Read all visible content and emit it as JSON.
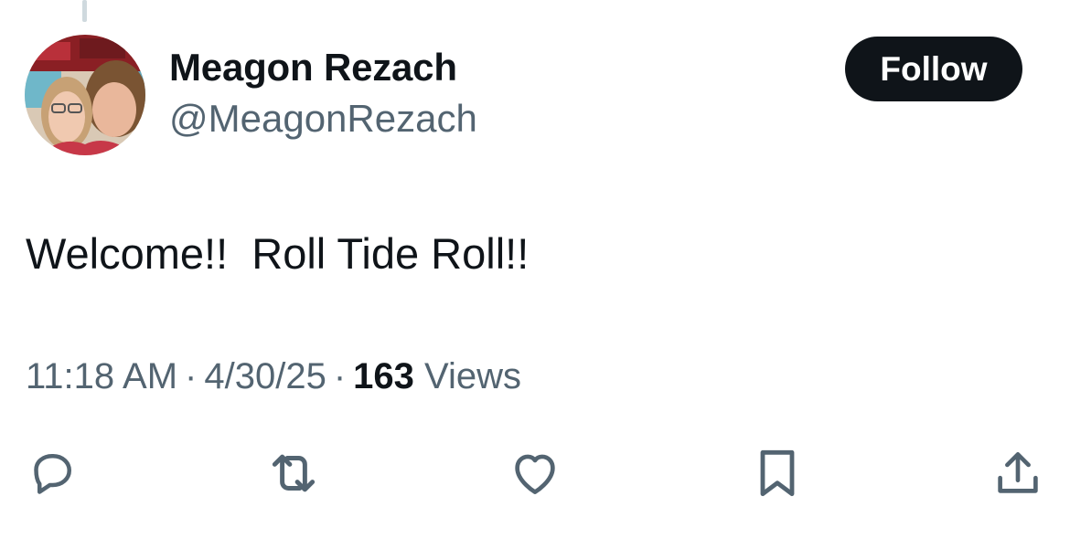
{
  "tweet": {
    "author_name": "Meagon Rezach",
    "author_handle": "@MeagonRezach",
    "follow_label": "Follow",
    "text": "Welcome!!  Roll Tide Roll!!",
    "time": "11:18 AM",
    "separator": "·",
    "date": "4/30/25",
    "views_count": "163",
    "views_label": "Views"
  },
  "icons": {
    "reply": "reply-icon",
    "repost": "repost-icon",
    "like": "heart-icon",
    "bookmark": "bookmark-icon",
    "share": "share-icon"
  },
  "colors": {
    "text_primary": "#0f1419",
    "text_secondary": "#536471",
    "follow_bg": "#0f1419",
    "follow_text": "#ffffff",
    "thread_line": "#cfd9de"
  }
}
